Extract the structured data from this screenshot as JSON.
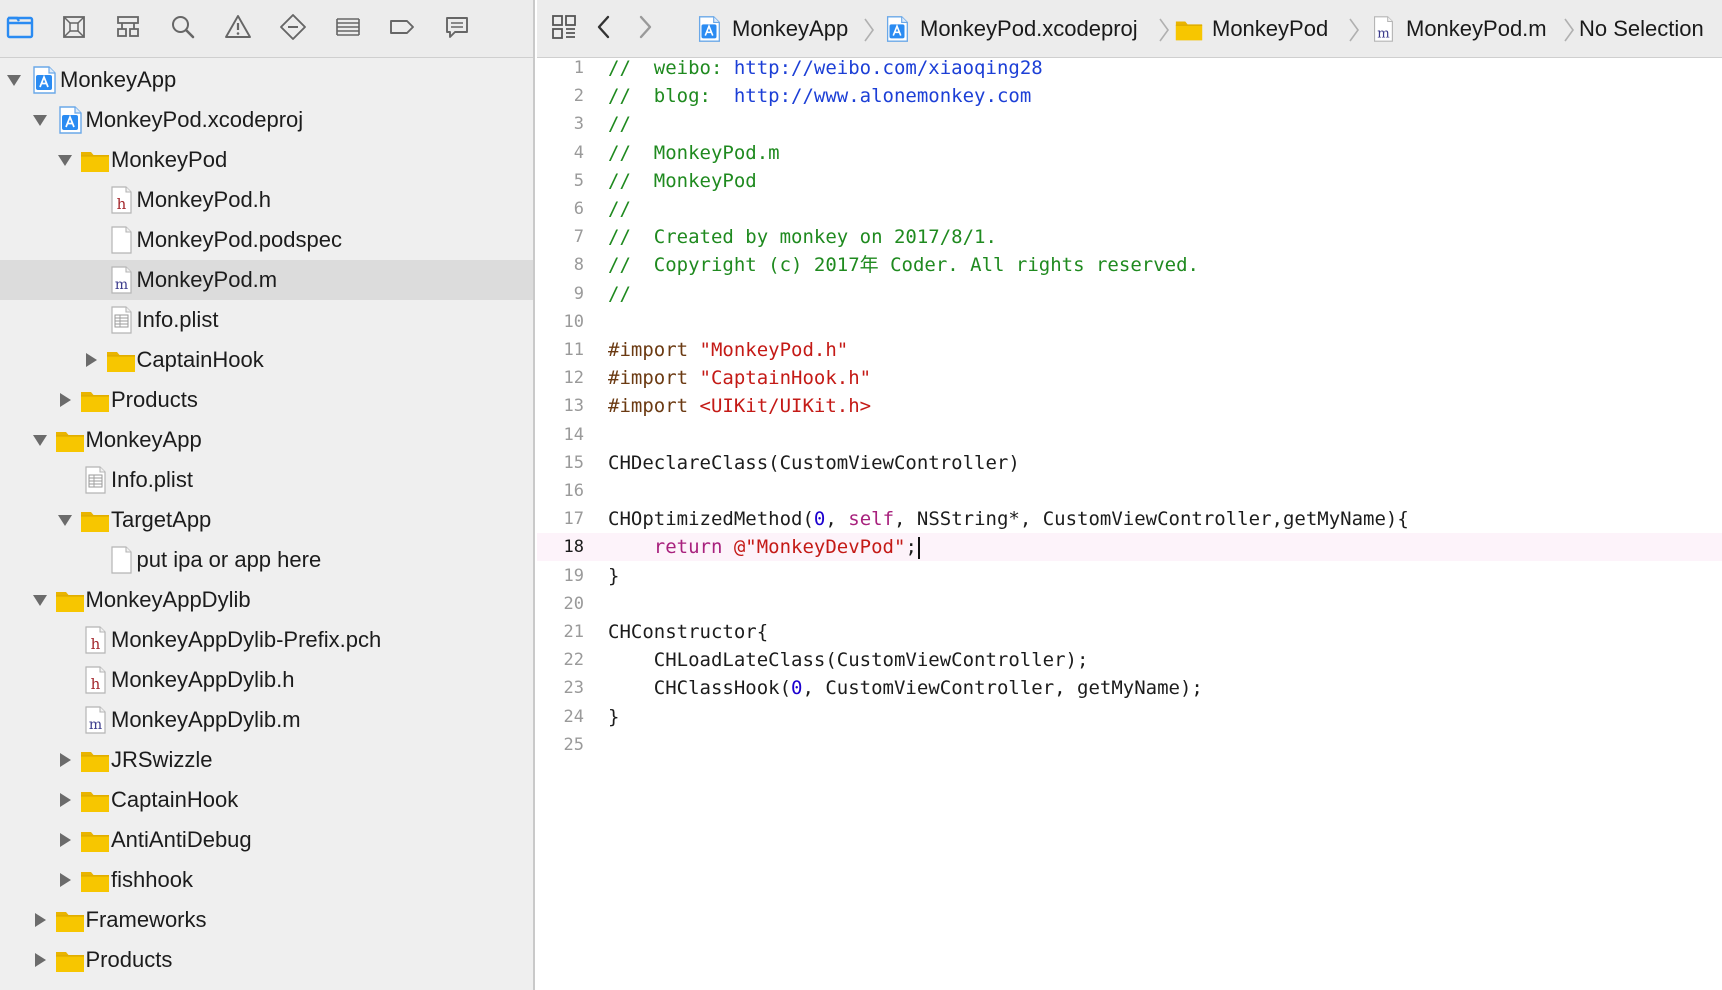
{
  "colors": {
    "accent": "#2a8bf2",
    "folder": "#f5c200",
    "comment": "#1f8a1f",
    "url": "#1c3fd6",
    "preprocessor": "#6b3a12",
    "string": "#c41a16",
    "keyword": "#a8217d",
    "number": "#1c00cf",
    "selected_row": "#dcdcdc",
    "current_line": "#fdf3fa"
  },
  "navigator_tabs": [
    {
      "icon": "project-navigator-icon",
      "active": true
    },
    {
      "icon": "source-control-icon",
      "active": false
    },
    {
      "icon": "symbol-navigator-icon",
      "active": false
    },
    {
      "icon": "find-navigator-icon",
      "active": false
    },
    {
      "icon": "issue-navigator-icon",
      "active": false
    },
    {
      "icon": "test-navigator-icon",
      "active": false
    },
    {
      "icon": "debug-navigator-icon",
      "active": false
    },
    {
      "icon": "breakpoint-navigator-icon",
      "active": false
    },
    {
      "icon": "report-navigator-icon",
      "active": false
    }
  ],
  "file_tree": [
    {
      "label": "MonkeyApp",
      "icon": "xcode-project-icon",
      "depth": 0,
      "disclosure": "expanded"
    },
    {
      "label": "MonkeyPod.xcodeproj",
      "icon": "xcode-project-icon",
      "depth": 1,
      "disclosure": "expanded"
    },
    {
      "label": "MonkeyPod",
      "icon": "folder-icon",
      "depth": 2,
      "disclosure": "expanded"
    },
    {
      "label": "MonkeyPod.h",
      "icon": "header-file-icon",
      "depth": 3,
      "disclosure": "none"
    },
    {
      "label": "MonkeyPod.podspec",
      "icon": "blank-file-icon",
      "depth": 3,
      "disclosure": "none"
    },
    {
      "label": "MonkeyPod.m",
      "icon": "objc-file-icon",
      "depth": 3,
      "disclosure": "none",
      "selected": true
    },
    {
      "label": "Info.plist",
      "icon": "plist-file-icon",
      "depth": 3,
      "disclosure": "none"
    },
    {
      "label": "CaptainHook",
      "icon": "folder-icon",
      "depth": 3,
      "disclosure": "collapsed"
    },
    {
      "label": "Products",
      "icon": "folder-icon",
      "depth": 2,
      "disclosure": "collapsed"
    },
    {
      "label": "MonkeyApp",
      "icon": "folder-icon",
      "depth": 1,
      "disclosure": "expanded"
    },
    {
      "label": "Info.plist",
      "icon": "plist-file-icon",
      "depth": 2,
      "disclosure": "none"
    },
    {
      "label": "TargetApp",
      "icon": "folder-icon",
      "depth": 2,
      "disclosure": "expanded"
    },
    {
      "label": "put ipa or app here",
      "icon": "blank-file-icon",
      "depth": 3,
      "disclosure": "none"
    },
    {
      "label": "MonkeyAppDylib",
      "icon": "folder-icon",
      "depth": 1,
      "disclosure": "expanded"
    },
    {
      "label": "MonkeyAppDylib-Prefix.pch",
      "icon": "header-file-icon",
      "depth": 2,
      "disclosure": "none"
    },
    {
      "label": "MonkeyAppDylib.h",
      "icon": "header-file-icon",
      "depth": 2,
      "disclosure": "none"
    },
    {
      "label": "MonkeyAppDylib.m",
      "icon": "objc-file-icon",
      "depth": 2,
      "disclosure": "none"
    },
    {
      "label": "JRSwizzle",
      "icon": "folder-icon",
      "depth": 2,
      "disclosure": "collapsed"
    },
    {
      "label": "CaptainHook",
      "icon": "folder-icon",
      "depth": 2,
      "disclosure": "collapsed"
    },
    {
      "label": "AntiAntiDebug",
      "icon": "folder-icon",
      "depth": 2,
      "disclosure": "collapsed"
    },
    {
      "label": "fishhook",
      "icon": "folder-icon",
      "depth": 2,
      "disclosure": "collapsed"
    },
    {
      "label": "Frameworks",
      "icon": "folder-icon",
      "depth": 1,
      "disclosure": "collapsed"
    },
    {
      "label": "Products",
      "icon": "folder-icon",
      "depth": 1,
      "disclosure": "collapsed"
    }
  ],
  "jump_bar": {
    "related_items_icon": "related-items-icon",
    "back_icon": "chevron-left-icon",
    "forward_icon": "chevron-right-icon",
    "crumbs": [
      {
        "label": "MonkeyApp",
        "icon": "xcode-project-icon"
      },
      {
        "label": "MonkeyPod.xcodeproj",
        "icon": "xcode-project-icon"
      },
      {
        "label": "MonkeyPod",
        "icon": "folder-icon"
      },
      {
        "label": "MonkeyPod.m",
        "icon": "objc-file-icon"
      },
      {
        "label": "No Selection",
        "icon": ""
      }
    ]
  },
  "editor": {
    "current_line": 18,
    "lines": [
      [
        [
          "comment",
          "//  weibo: "
        ],
        [
          "url",
          "http://weibo.com/xiaoqing28"
        ]
      ],
      [
        [
          "comment",
          "//  blog:  "
        ],
        [
          "url",
          "http://www.alonemonkey.com"
        ]
      ],
      [
        [
          "comment",
          "//"
        ]
      ],
      [
        [
          "comment",
          "//  MonkeyPod.m"
        ]
      ],
      [
        [
          "comment",
          "//  MonkeyPod"
        ]
      ],
      [
        [
          "comment",
          "//"
        ]
      ],
      [
        [
          "comment",
          "//  Created by monkey on 2017/8/1."
        ]
      ],
      [
        [
          "comment",
          "//  Copyright (c) 2017年 Coder. All rights reserved."
        ]
      ],
      [
        [
          "comment",
          "//"
        ]
      ],
      [],
      [
        [
          "pre",
          "#import "
        ],
        [
          "str",
          "\"MonkeyPod.h\""
        ]
      ],
      [
        [
          "pre",
          "#import "
        ],
        [
          "str",
          "\"CaptainHook.h\""
        ]
      ],
      [
        [
          "pre",
          "#import "
        ],
        [
          "str",
          "<UIKit/UIKit.h>"
        ]
      ],
      [],
      [
        [
          "plain",
          "CHDeclareClass(CustomViewController)"
        ]
      ],
      [],
      [
        [
          "plain",
          "CHOptimizedMethod("
        ],
        [
          "num",
          "0"
        ],
        [
          "plain",
          ", "
        ],
        [
          "kw",
          "self"
        ],
        [
          "plain",
          ", NSString*, CustomViewController,getMyName){"
        ]
      ],
      [
        [
          "plain",
          "    "
        ],
        [
          "kw",
          "return "
        ],
        [
          "str",
          "@\"MonkeyDevPod\""
        ],
        [
          "plain",
          ";"
        ]
      ],
      [
        [
          "plain",
          "}"
        ]
      ],
      [],
      [
        [
          "plain",
          "CHConstructor{"
        ]
      ],
      [
        [
          "plain",
          "    CHLoadLateClass(CustomViewController);"
        ]
      ],
      [
        [
          "plain",
          "    CHClassHook("
        ],
        [
          "num",
          "0"
        ],
        [
          "plain",
          ", CustomViewController, getMyName);"
        ]
      ],
      [
        [
          "plain",
          "}"
        ]
      ],
      []
    ]
  }
}
